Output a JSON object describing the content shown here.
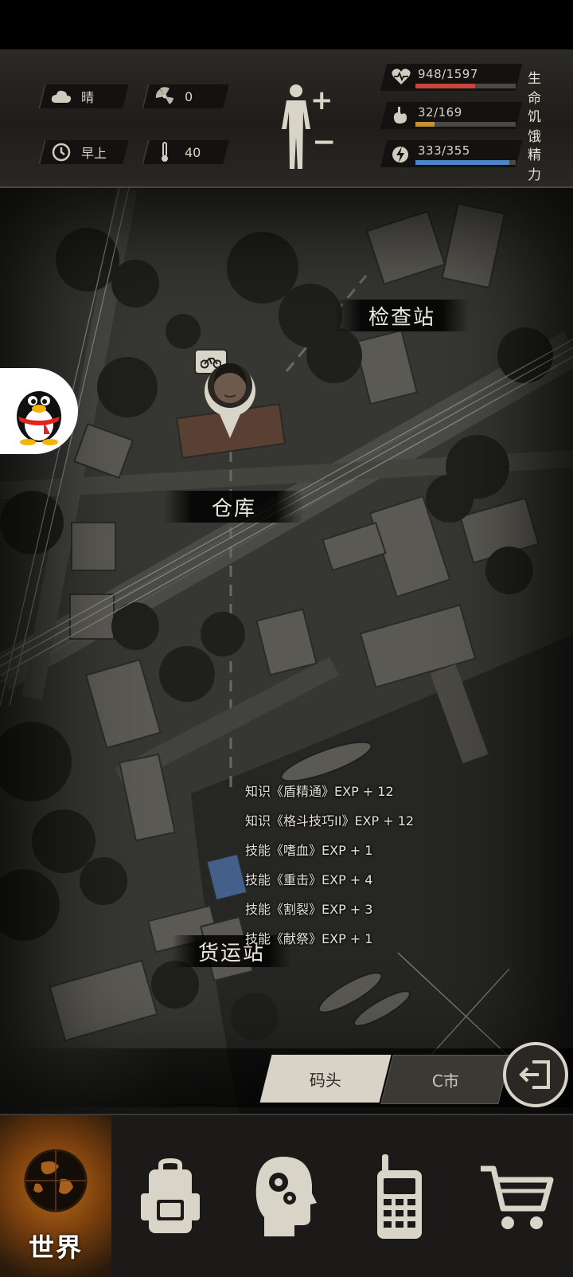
{
  "hud": {
    "weather": "晴",
    "radiation": "0",
    "time_of_day": "早上",
    "temperature": "40",
    "stats": [
      {
        "label": "生命",
        "value": "948/1597",
        "fraction": 0.594,
        "color": "#c9463a",
        "icon": "heart-icon"
      },
      {
        "label": "饥饿",
        "value": "32/169",
        "fraction": 0.19,
        "color": "#c8932e",
        "icon": "stomach-icon"
      },
      {
        "label": "精力",
        "value": "333/355",
        "fraction": 0.938,
        "color": "#4b86c4",
        "icon": "energy-icon"
      }
    ]
  },
  "map": {
    "locations": {
      "checkpoint": "检查站",
      "warehouse": "仓库",
      "freight_station": "货运站"
    },
    "log": [
      "知识《盾精通》EXP + 12",
      "知识《格斗技巧II》EXP + 12",
      "技能《嗜血》EXP + 1",
      "技能《重击》EXP + 4",
      "技能《割裂》EXP + 3",
      "技能《献祭》EXP + 1"
    ]
  },
  "destinations": {
    "current": "码头",
    "next": "C市"
  },
  "nav": {
    "items": [
      {
        "label": "世界",
        "icon": "globe-icon",
        "active": true
      },
      {
        "label": "",
        "icon": "backpack-icon",
        "active": false
      },
      {
        "label": "",
        "icon": "mind-gear-icon",
        "active": false
      },
      {
        "label": "",
        "icon": "radio-icon",
        "active": false
      },
      {
        "label": "",
        "icon": "cart-icon",
        "active": false
      }
    ]
  }
}
